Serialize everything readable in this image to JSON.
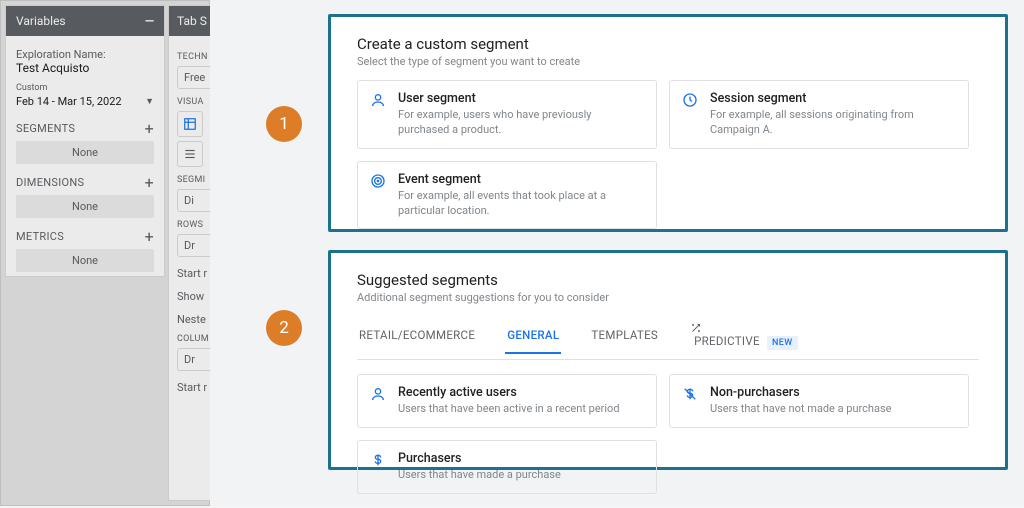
{
  "variables_panel": {
    "header": "Variables",
    "exploration_name_label": "Exploration Name:",
    "exploration_name_value": "Test Acquisto",
    "custom_label": "Custom",
    "date_range": "Feb 14 - Mar 15, 2022",
    "segments_label": "SEGMENTS",
    "dimensions_label": "DIMENSIONS",
    "metrics_label": "METRICS",
    "none_text": "None"
  },
  "tab_settings": {
    "header": "Tab S",
    "technique_label": "TECHN",
    "technique_value": "Free",
    "visualization_label": "VISUA",
    "segment_comp_label": "SEGMI",
    "segment_comp_value": "Di",
    "rows_label": "ROWS",
    "rows_value": "Dr",
    "start_label": "Start r",
    "show_label": "Show",
    "nested_label": "Neste",
    "columns_label": "COLUM",
    "columns_value": "Dr",
    "start2_label": "Start r"
  },
  "custom_segment": {
    "title": "Create a custom segment",
    "subtitle": "Select the type of segment you want to create",
    "cards": {
      "user": {
        "title": "User segment",
        "desc": "For example, users who have previously purchased a product."
      },
      "session": {
        "title": "Session segment",
        "desc": "For example, all sessions originating from Campaign A."
      },
      "event": {
        "title": "Event segment",
        "desc": "For example, all events that took place at a particular location."
      }
    }
  },
  "suggested": {
    "title": "Suggested segments",
    "subtitle": "Additional segment suggestions for you to consider",
    "tabs": {
      "retail": "RETAIL/ECOMMERCE",
      "general": "GENERAL",
      "templates": "TEMPLATES",
      "predictive": "PREDICTIVE",
      "new_badge": "NEW"
    },
    "cards": {
      "recent": {
        "title": "Recently active users",
        "desc": "Users that have been active in a recent period"
      },
      "nonpurch": {
        "title": "Non-purchasers",
        "desc": "Users that have not made a purchase"
      },
      "purch": {
        "title": "Purchasers",
        "desc": "Users that have made a purchase"
      }
    }
  },
  "badges": {
    "one": "1",
    "two": "2"
  }
}
